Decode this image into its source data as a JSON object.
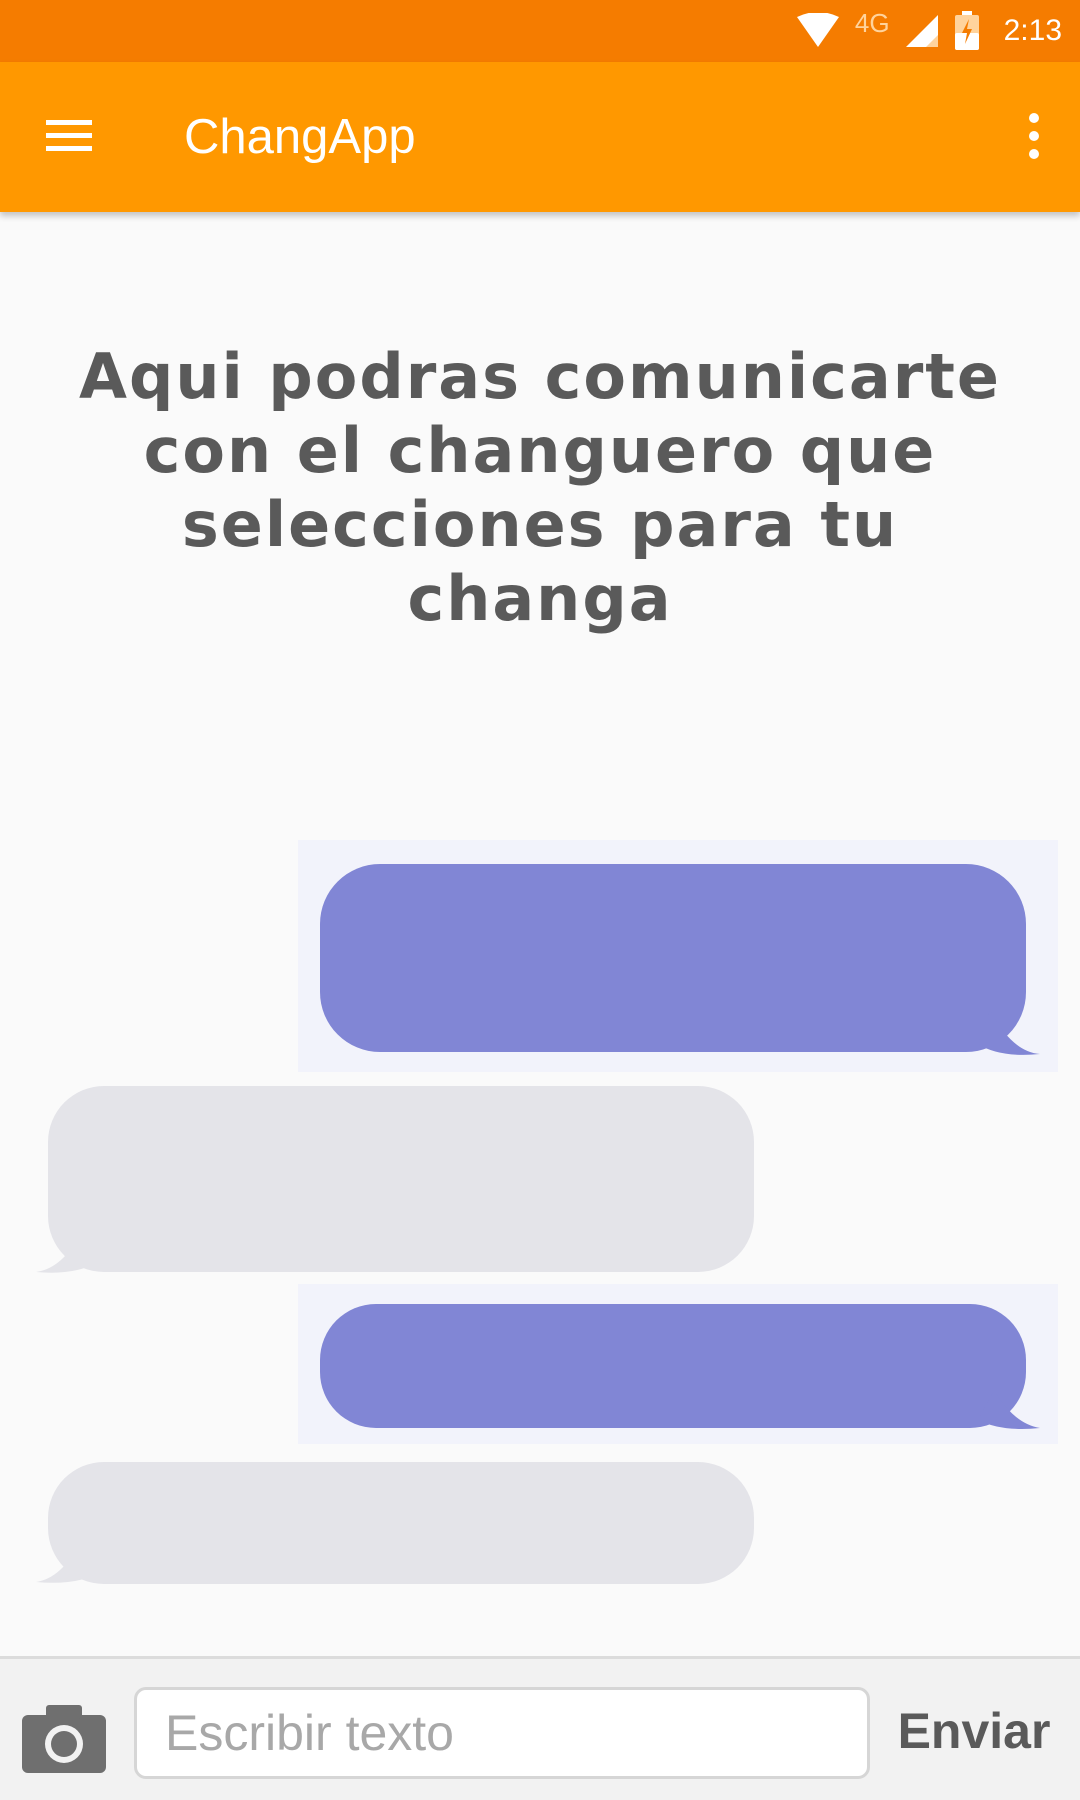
{
  "status_bar": {
    "time": "2:13",
    "network": "4G",
    "icons": [
      "wifi-icon",
      "signal-icon",
      "battery-icon"
    ]
  },
  "app_bar": {
    "title": "ChangApp",
    "icons": [
      "menu-icon",
      "overflow-menu-icon"
    ],
    "color": "#ff9800",
    "status_color": "#f57c00"
  },
  "main": {
    "headline": "Aqui podras comunicarte con el changuero que selecciones para tu changa",
    "illustration": {
      "sent_bubble_color": "#8186d5",
      "received_bubble_color": "#e4e4e9"
    }
  },
  "composer": {
    "placeholder": "Escribir texto",
    "value": "",
    "send_label": "Enviar",
    "camera_icon": "camera-icon"
  }
}
